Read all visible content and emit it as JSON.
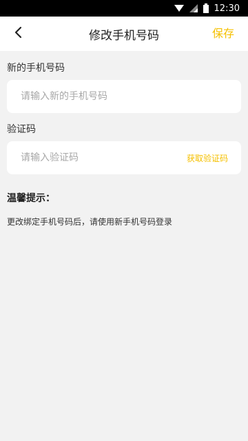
{
  "status_bar": {
    "time": "12:30"
  },
  "nav": {
    "back_icon": "chevron-left-icon",
    "title": "修改手机号码",
    "save_label": "保存"
  },
  "new_phone": {
    "label": "新的手机号码",
    "placeholder": "请输入新的手机号码"
  },
  "verification": {
    "label": "验证码",
    "placeholder": "请输入验证码",
    "get_code_label": "获取验证码"
  },
  "tips": {
    "title": "温馨提示：",
    "text": "更改绑定手机号码后，请使用新手机号码登录"
  },
  "colors": {
    "accent": "#f5c000",
    "background": "#f2f2f2",
    "card": "#ffffff"
  }
}
